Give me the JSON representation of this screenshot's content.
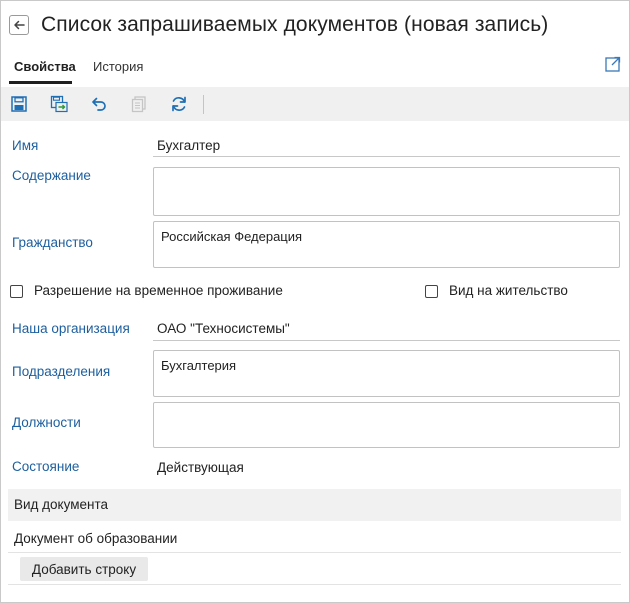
{
  "header": {
    "title": "Список запрашиваемых документов (новая запись)",
    "back_icon": "arrow-left-icon"
  },
  "tabs": [
    {
      "label": "Свойства",
      "active": true
    },
    {
      "label": "История",
      "active": false
    }
  ],
  "toolbar": {
    "icons": [
      "save-icon",
      "save-and-close-icon",
      "undo-icon",
      "copy-icon",
      "refresh-icon"
    ]
  },
  "form": {
    "name": {
      "label": "Имя",
      "value": "Бухгалтер"
    },
    "content": {
      "label": "Содержание",
      "value": ""
    },
    "citizenship": {
      "label": "Гражданство",
      "value": "Российская Федерация"
    },
    "temp_residence": {
      "label": "Разрешение на временное проживание",
      "checked": false
    },
    "residence_permit": {
      "label": "Вид на жительство",
      "checked": false
    },
    "organization": {
      "label": "Наша организация",
      "value": "ОАО \"Техносистемы\""
    },
    "departments": {
      "label": "Подразделения",
      "value": "Бухгалтерия"
    },
    "positions": {
      "label": "Должности",
      "value": ""
    },
    "state": {
      "label": "Состояние",
      "value": "Действующая"
    }
  },
  "table": {
    "column_header": "Вид документа",
    "rows": [
      "Документ об образовании"
    ],
    "add_row_label": "Добавить строку"
  },
  "colors": {
    "link_label": "#1d5f9e",
    "toolbar_icon": "#1f6fb5",
    "toolbar_bg": "#f0f0f0"
  }
}
